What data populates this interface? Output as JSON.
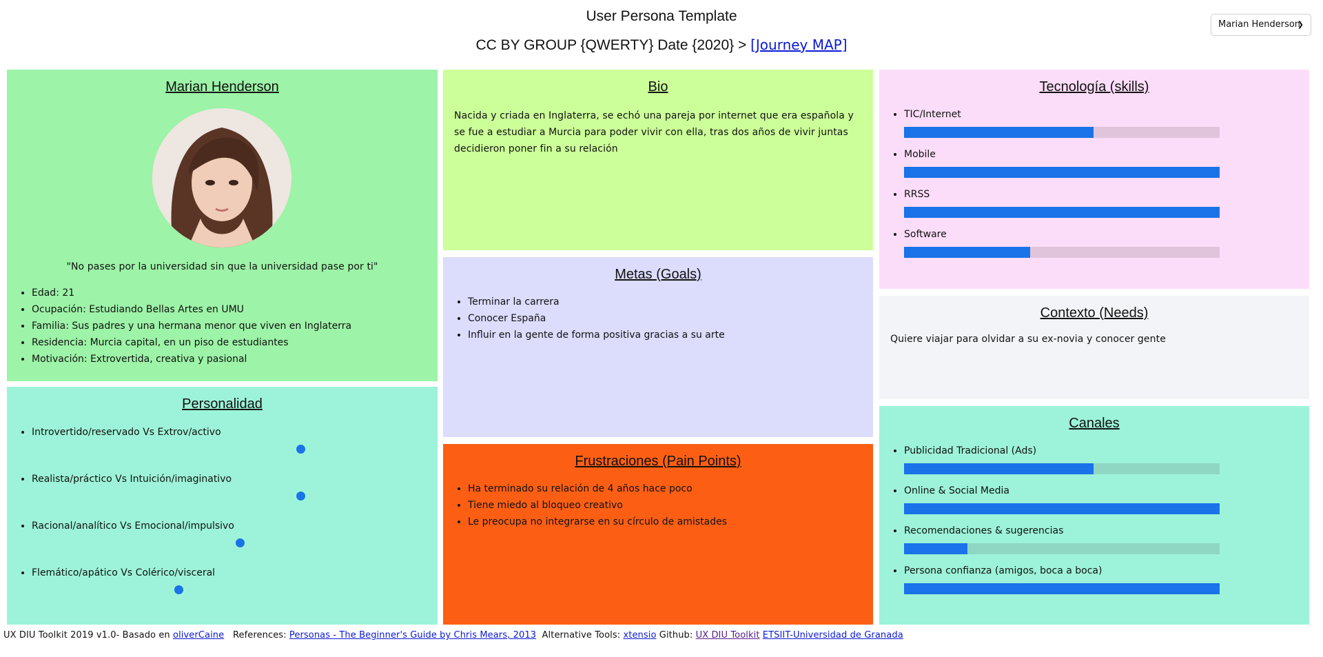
{
  "header": {
    "title": "User Persona Template",
    "subtitle": "CC BY GROUP {QWERTY} Date {2020} >",
    "journey_link": "[Journey MAP]"
  },
  "persona_select": {
    "value": "Marian Henderson"
  },
  "profile": {
    "name": "Marian Henderson",
    "quote": "\"No pases por la universidad sin que la universidad pase por ti\"",
    "facts": [
      "Edad: 21",
      "Ocupación: Estudiando Bellas Artes en UMU",
      "Familia: Sus padres y una hermana menor que viven en Inglaterra",
      "Residencia: Murcia capital, en un piso de estudiantes",
      "Motivación: Extrovertida, creativa y pasional"
    ]
  },
  "personality": {
    "title": "Personalidad",
    "traits": [
      {
        "label": "Introvertido/reservado Vs Extrov/activo",
        "level": 0.75
      },
      {
        "label": "Realista/práctico Vs Intuición/imaginativo",
        "level": 0.75
      },
      {
        "label": "Racional/analítico Vs Emocional/impulsivo",
        "level": 0.58
      },
      {
        "label": "Flemático/apático Vs Colérico/visceral",
        "level": 0.41
      }
    ]
  },
  "bio": {
    "title": "Bio",
    "text": "Nacida y criada en Inglaterra, se echó una pareja por internet que era española y se fue a estudiar a Murcia para poder vivir con ella, tras dos años de vivir juntas decidieron poner fin a su relación"
  },
  "goals": {
    "title": "Metas (Goals)",
    "items": [
      "Terminar la carrera",
      "Conocer España",
      "Influir en la gente de forma positiva gracias a su arte"
    ]
  },
  "frustrations": {
    "title": "Frustraciones (Pain Points)",
    "items": [
      "Ha terminado su relación de 4 años hace poco",
      "Tiene miedo al bloqueo creativo",
      "Le preocupa no integrarse en su círculo de amistades"
    ]
  },
  "technology": {
    "title": "Tecnología (skills)",
    "skills": [
      {
        "label": "TIC/Internet",
        "level": 0.6
      },
      {
        "label": "Mobile",
        "level": 1.0
      },
      {
        "label": "RRSS",
        "level": 1.0
      },
      {
        "label": "Software",
        "level": 0.4
      }
    ]
  },
  "context": {
    "title": "Contexto (Needs)",
    "text": "Quiere viajar para olvidar a su ex-novia y conocer gente"
  },
  "channels": {
    "title": "Canales",
    "items": [
      {
        "label": "Publicidad Tradicional (Ads)",
        "level": 0.6
      },
      {
        "label": "Online & Social Media",
        "level": 1.0
      },
      {
        "label": "Recomendaciones & sugerencias",
        "level": 0.2
      },
      {
        "label": "Persona confianza (amigos, boca a boca)",
        "level": 1.0
      }
    ]
  },
  "footer": {
    "prefix": "UX DIU Toolkit 2019 v1.0- Basado en",
    "link_olivercaine": "oliverCaine",
    "references_label": "References:",
    "link_personas": "Personas - The Beginner's Guide by Chris Mears, 2013",
    "tools_label": "Alternative Tools:",
    "link_xtensio": "xtensio",
    "github_label": "Github:",
    "link_toolkit": "UX DIU Toolkit",
    "link_etsiit": "ETSIIT-Universidad de Granada"
  },
  "colors": {
    "profile_bg": "#9df3a7",
    "personality_bg": "#9df3d9",
    "bio_bg": "#ccff99",
    "goals_bg": "#dcdcfc",
    "frustrations_bg": "#fc5f14",
    "technology_bg": "#fcddf9",
    "context_bg": "#f2f4f7",
    "channels_bg": "#9df3d9",
    "bar_fill": "#1a73e8",
    "tech_track": "#e0c4dc",
    "channel_track": "#8fd6c3"
  }
}
